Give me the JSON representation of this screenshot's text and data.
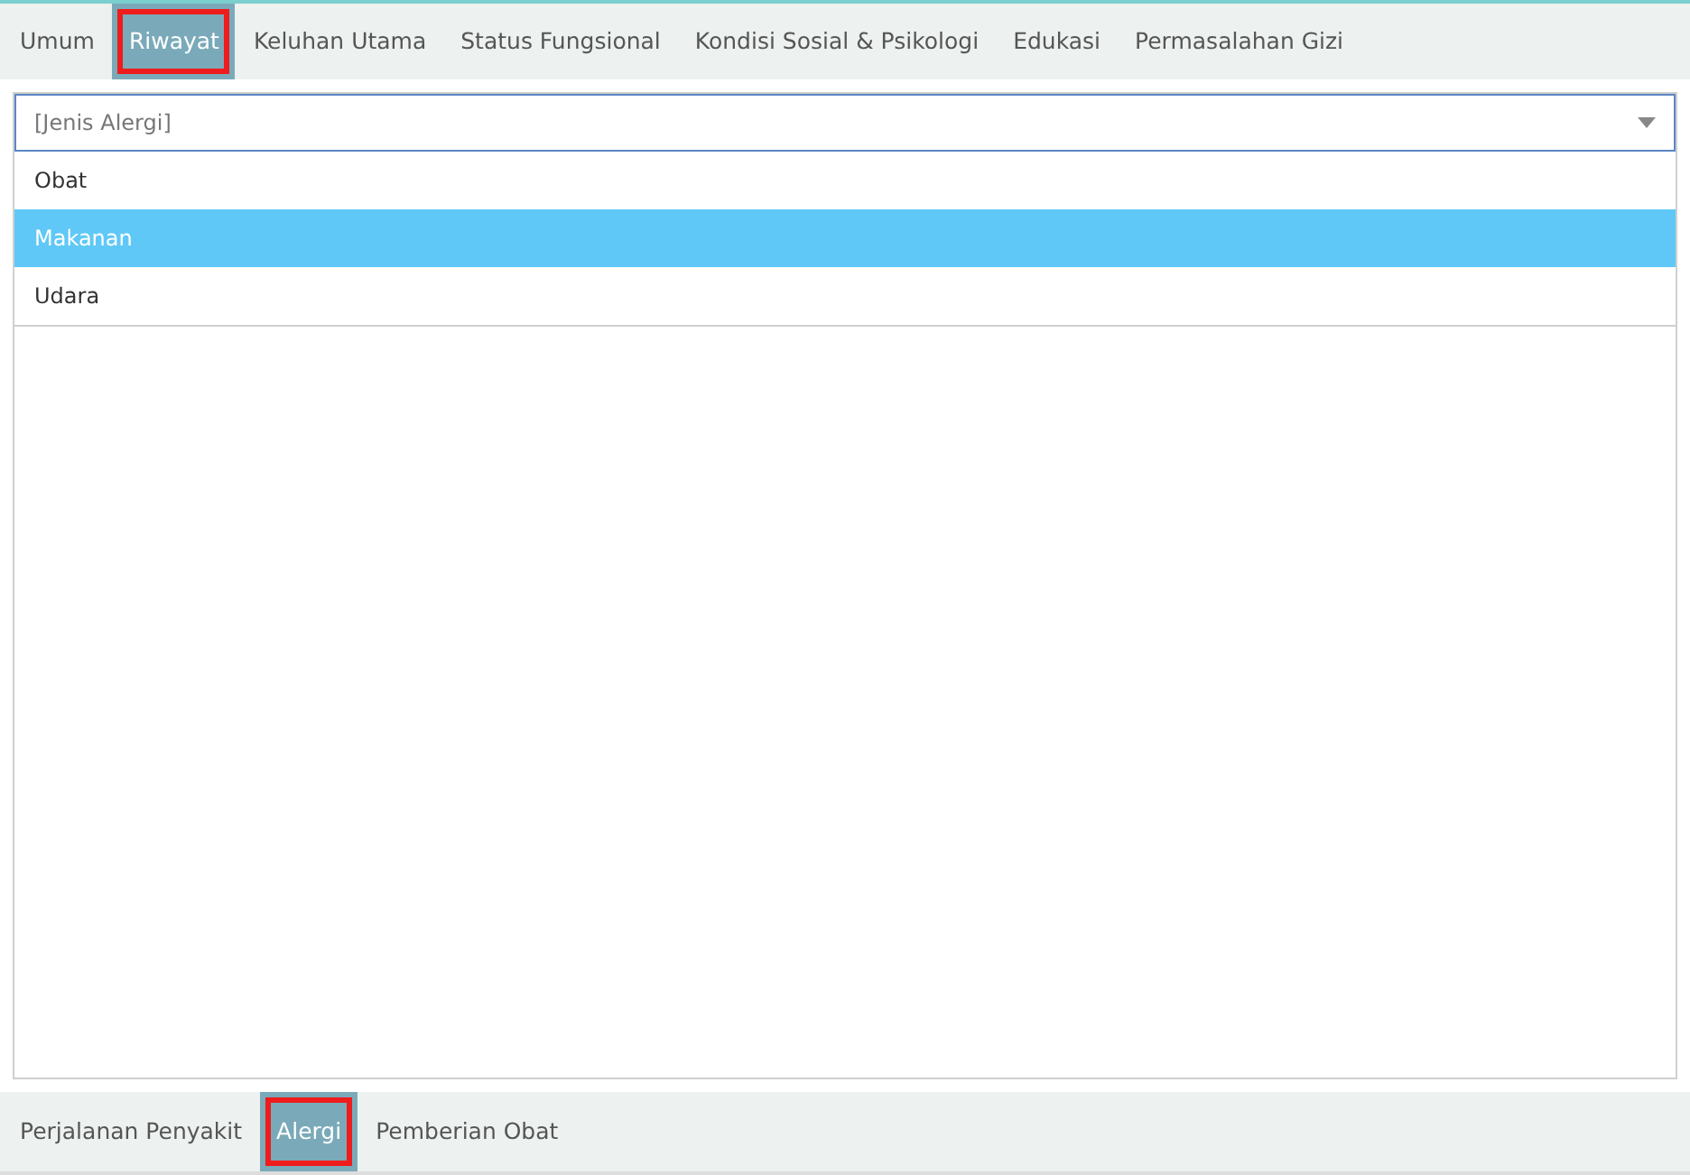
{
  "top_tabs": [
    {
      "label": "Umum",
      "selected": false,
      "highlighted": false
    },
    {
      "label": "Riwayat",
      "selected": true,
      "highlighted": true
    },
    {
      "label": "Keluhan Utama",
      "selected": false,
      "highlighted": false
    },
    {
      "label": "Status Fungsional",
      "selected": false,
      "highlighted": false
    },
    {
      "label": "Kondisi Sosial & Psikologi",
      "selected": false,
      "highlighted": false
    },
    {
      "label": "Edukasi",
      "selected": false,
      "highlighted": false
    },
    {
      "label": "Permasalahan Gizi",
      "selected": false,
      "highlighted": false
    }
  ],
  "select": {
    "placeholder": "[Jenis Alergi]",
    "expanded": true
  },
  "options": [
    {
      "label": "Obat",
      "selected": false
    },
    {
      "label": "Makanan",
      "selected": true
    },
    {
      "label": "Udara",
      "selected": false
    }
  ],
  "bottom_tabs": [
    {
      "label": "Perjalanan Penyakit",
      "selected": false,
      "highlighted": false
    },
    {
      "label": "Alergi",
      "selected": true,
      "highlighted": true
    },
    {
      "label": "Pemberian Obat",
      "selected": false,
      "highlighted": false
    }
  ]
}
